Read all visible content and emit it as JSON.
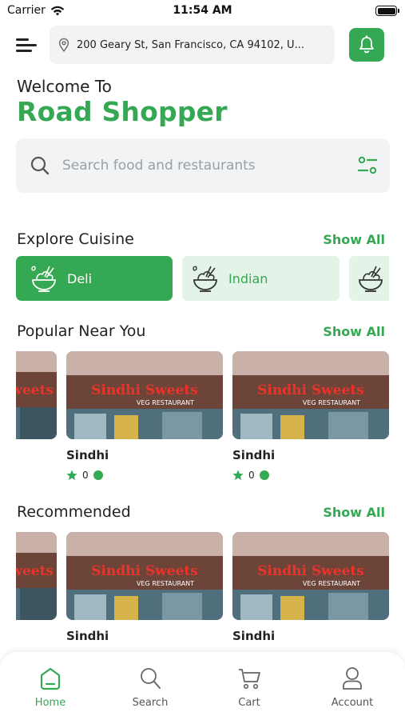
{
  "status_bar": {
    "carrier": "Carrier",
    "time": "11:54 AM"
  },
  "header": {
    "address": "200 Geary St, San Francisco, CA 94102, U...",
    "welcome": "Welcome To",
    "brand": "Road Shopper"
  },
  "search": {
    "placeholder": "Search food and restaurants"
  },
  "cuisine": {
    "title": "Explore Cuisine",
    "show_all": "Show All",
    "items": [
      {
        "label": "Deli",
        "active": true
      },
      {
        "label": "Indian",
        "active": false
      },
      {
        "label": "",
        "active": false
      }
    ]
  },
  "popular": {
    "title": "Popular Near You",
    "show_all": "Show All",
    "cards": [
      {
        "name": "Sindhi",
        "rating": "0"
      },
      {
        "name": "Sindhi",
        "rating": "0"
      }
    ]
  },
  "recommended": {
    "title": "Recommended",
    "show_all": "Show All",
    "cards": [
      {
        "name": "Sindhi"
      },
      {
        "name": "Sindhi"
      }
    ]
  },
  "storefront": {
    "sign": "Sindhi Sweets",
    "subsign": "VEG RESTAURANT"
  },
  "nav": {
    "home": "Home",
    "search": "Search",
    "cart": "Cart",
    "account": "Account"
  },
  "colors": {
    "accent": "#35a853",
    "chip_inactive": "#e3f3e7",
    "field_bg": "#f1f3f5"
  }
}
